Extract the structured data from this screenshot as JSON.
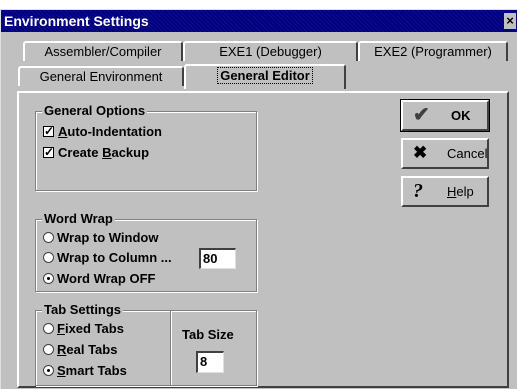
{
  "window": {
    "title": "Environment Settings",
    "close_glyph": "×"
  },
  "tabs": {
    "row_back": [
      "Assembler/Compiler",
      "EXE1 (Debugger)",
      "EXE2 (Programmer)"
    ],
    "row_front": [
      "General Environment",
      "General Editor"
    ],
    "active": "General Editor"
  },
  "general_options": {
    "legend": "General Options",
    "auto_indentation": {
      "pre": "",
      "accel": "A",
      "post": "uto-Indentation",
      "checked": true
    },
    "create_backup": {
      "pre": "Create ",
      "accel": "B",
      "post": "ackup",
      "checked": true
    }
  },
  "word_wrap": {
    "legend": "Word Wrap",
    "options": [
      "Wrap to Window",
      "Wrap to Column ...",
      "Word Wrap OFF"
    ],
    "selected": "Word Wrap OFF",
    "column_value": "80"
  },
  "tab_settings": {
    "legend": "Tab Settings",
    "fixed": {
      "accel": "F",
      "rest": "ixed Tabs"
    },
    "real": {
      "accel": "R",
      "rest": "eal Tabs"
    },
    "smart": {
      "accel": "S",
      "rest": "mart Tabs"
    },
    "selected": "Smart Tabs",
    "tab_size_label": "Tab Size",
    "tab_size_value": "8"
  },
  "buttons": {
    "ok": {
      "label": "OK",
      "icon": "checkmark-icon",
      "glyph": "✔"
    },
    "cancel": {
      "label": "Cancel",
      "icon": "x-icon",
      "glyph": "✖"
    },
    "help": {
      "accel": "H",
      "rest": "elp",
      "icon": "question-icon",
      "glyph": "?"
    }
  }
}
